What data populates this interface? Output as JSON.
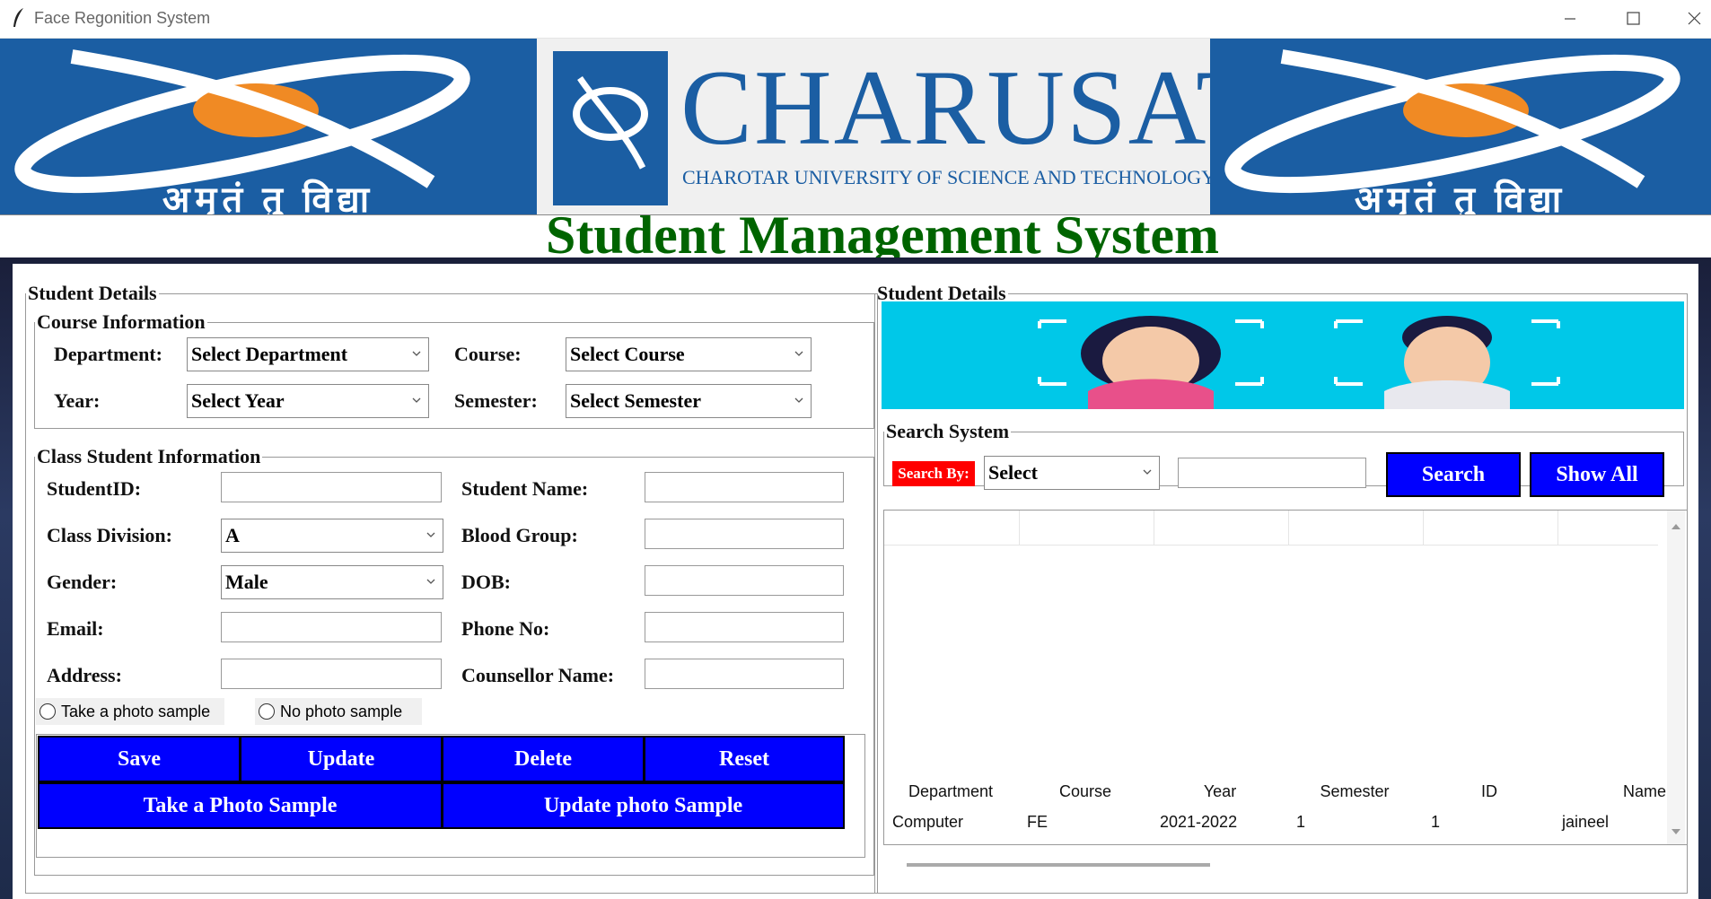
{
  "window": {
    "title": "Face Regonition System"
  },
  "banner": {
    "brand": "CHARUSAT",
    "university": "CHAROTAR UNIVERSITY OF SCIENCE AND TECHNOLOGY",
    "motto": "अमृतं तु विद्या"
  },
  "heading": "Student Management System",
  "left": {
    "legend": "Student Details",
    "course": {
      "legend": "Course Information",
      "department_label": "Department:",
      "department_value": "Select Department",
      "course_label": "Course:",
      "course_value": "Select Course",
      "year_label": "Year:",
      "year_value": "Select Year",
      "semester_label": "Semester:",
      "semester_value": "Select Semester"
    },
    "class": {
      "legend": "Class Student Information",
      "student_id_label": "StudentID:",
      "student_id_value": "",
      "student_name_label": "Student Name:",
      "student_name_value": "",
      "division_label": "Class Division:",
      "division_value": "A",
      "blood_label": "Blood Group:",
      "blood_value": "",
      "gender_label": "Gender:",
      "gender_value": "Male",
      "dob_label": "DOB:",
      "dob_value": "",
      "email_label": "Email:",
      "email_value": "",
      "phone_label": "Phone No:",
      "phone_value": "",
      "address_label": "Address:",
      "address_value": "",
      "counsellor_label": "Counsellor Name:",
      "counsellor_value": "",
      "radio_take": "Take a photo sample",
      "radio_no": "No photo sample"
    },
    "buttons": {
      "save": "Save",
      "update": "Update",
      "delete": "Delete",
      "reset": "Reset",
      "take_photo": "Take a Photo Sample",
      "update_photo": "Update photo Sample"
    }
  },
  "right": {
    "legend": "Student Details",
    "search": {
      "legend": "Search System",
      "by_label": "Search By:",
      "by_value": "Select",
      "query": "",
      "search_button": "Search",
      "show_all_button": "Show All"
    },
    "table": {
      "columns": [
        "Department",
        "Course",
        "Year",
        "Semester",
        "ID",
        "Name"
      ],
      "rows": [
        [
          "Computer",
          "FE",
          "2021-2022",
          "1",
          "1",
          "jaineel"
        ]
      ]
    }
  },
  "colors": {
    "button_blue": "#0000ff",
    "heading_green": "#006400",
    "banner_blue": "#1b5ea3",
    "search_label_red": "#ff0000",
    "face_banner_cyan": "#00c8e8"
  }
}
